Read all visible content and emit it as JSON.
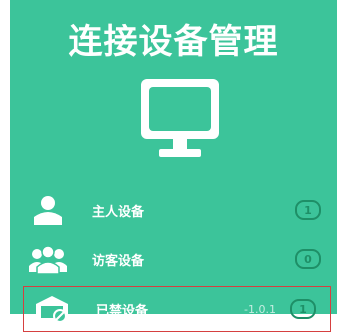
{
  "header": {
    "title": "连接设备管理"
  },
  "devices": [
    {
      "icon": "user-icon",
      "label": "主人设备",
      "count": "1"
    },
    {
      "icon": "users-icon",
      "label": "访客设备",
      "count": "0"
    },
    {
      "icon": "blocked-device-icon",
      "label": "已禁设备",
      "count": "1",
      "hint": "-1.0.1"
    }
  ],
  "colors": {
    "background": "#3cc49a",
    "badge": "#1e8f67",
    "highlight": "#d64040"
  }
}
